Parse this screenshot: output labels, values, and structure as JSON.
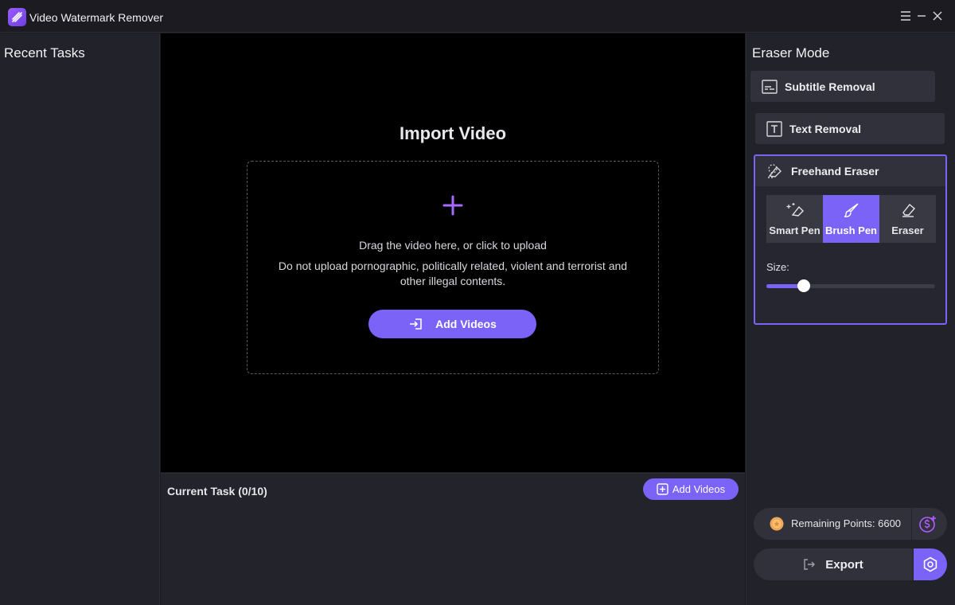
{
  "app": {
    "title": "Video Watermark Remover"
  },
  "left": {
    "title": "Recent Tasks"
  },
  "import": {
    "title": "Import Video",
    "drag_text": "Drag the video here, or click to upload",
    "notice": "Do not upload pornographic, politically related, violent and terrorist and other illegal contents.",
    "add_label": "Add Videos"
  },
  "tasks": {
    "title": "Current Task (0/10)",
    "add_label": "Add Videos"
  },
  "right": {
    "title": "Eraser Mode",
    "modes": {
      "subtitle": "Subtitle Removal",
      "text": "Text Removal",
      "freehand": "Freehand Eraser"
    },
    "tools": [
      {
        "label": "Smart Pen",
        "icon": "smart-pen-icon"
      },
      {
        "label": "Brush Pen",
        "icon": "brush-icon",
        "active": true
      },
      {
        "label": "Eraser",
        "icon": "eraser-icon"
      }
    ],
    "size_label": "Size:",
    "size_value": 0.22,
    "points_text": "Remaining Points: 6600",
    "export_label": "Export"
  },
  "colors": {
    "accent": "#7a63f6",
    "panel": "#21222a",
    "button": "#30313a",
    "preview": "#000000"
  }
}
